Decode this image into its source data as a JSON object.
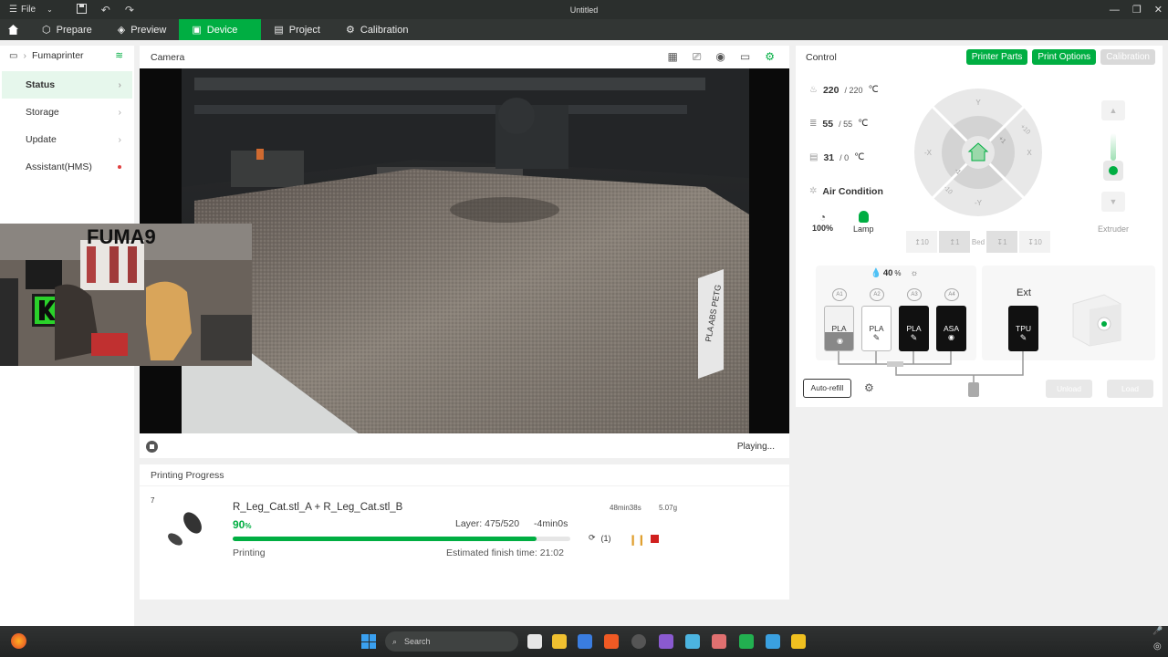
{
  "titlebar": {
    "file_label": "File",
    "window_title": "Untitled"
  },
  "nav": {
    "tabs": [
      {
        "label": "Prepare"
      },
      {
        "label": "Preview"
      },
      {
        "label": "Device"
      },
      {
        "label": "Project"
      },
      {
        "label": "Calibration"
      }
    ]
  },
  "sidebar": {
    "printer_name": "Fumaprinter",
    "items": [
      {
        "label": "Status"
      },
      {
        "label": "Storage"
      },
      {
        "label": "Update"
      },
      {
        "label": "Assistant(HMS)"
      }
    ]
  },
  "camera": {
    "title": "Camera",
    "status": "Playing...",
    "overlay_text": "FUMA9",
    "bed_label": "PLA ABS PETG"
  },
  "progress": {
    "title": "Printing Progress",
    "index": "7",
    "file_name": "R_Leg_Cat.stl_A + R_Leg_Cat.stl_B",
    "percent": "90",
    "percent_unit": "%",
    "percent_value": 0.9,
    "layer": "Layer: 475/520",
    "remaining": "-4min0s",
    "duration": "48min38s",
    "weight": "5.07g",
    "state": "Printing",
    "finish": "Estimated finish time: 21:02",
    "retry_count": "(1)"
  },
  "control": {
    "title": "Control",
    "buttons": {
      "printer_parts": "Printer Parts",
      "print_options": "Print Options",
      "calibration": "Calibration"
    },
    "nozzle": {
      "current": "220",
      "target": "/ 220",
      "unit": "℃"
    },
    "bed": {
      "current": "55",
      "target": "/ 55",
      "unit": "℃"
    },
    "chamber": {
      "current": "31",
      "target": "/ 0",
      "unit": "℃"
    },
    "air_condition": "Air Condition",
    "fan": {
      "value": "100%"
    },
    "lamp": "Lamp",
    "jog": {
      "y_plus": "Y",
      "y_minus": "-Y",
      "x_plus": "X",
      "x_minus": "-X",
      "p10": "+10",
      "p1": "+1",
      "m1": "-1",
      "m10": "-10"
    },
    "bed_buttons": [
      "10",
      "1",
      "Bed",
      "1",
      "10"
    ],
    "extruder": "Extruder"
  },
  "ams": {
    "humidity": "40",
    "humidity_unit": "%",
    "slots": [
      {
        "id": "A1",
        "material": "PLA",
        "color": "#f0f0f0"
      },
      {
        "id": "A2",
        "material": "PLA",
        "color": "#ffffff"
      },
      {
        "id": "A3",
        "material": "PLA",
        "color": "#111111"
      },
      {
        "id": "A4",
        "material": "ASA",
        "color": "#111111"
      }
    ],
    "ext_label": "Ext",
    "ext_material": "TPU",
    "autorefill": "Auto-refill",
    "unload": "Unload",
    "load": "Load"
  },
  "taskbar": {
    "search": "Search"
  },
  "colors": {
    "accent": "#00ae42",
    "nav_bg": "#323634",
    "title_bg": "#2b2f2d"
  }
}
